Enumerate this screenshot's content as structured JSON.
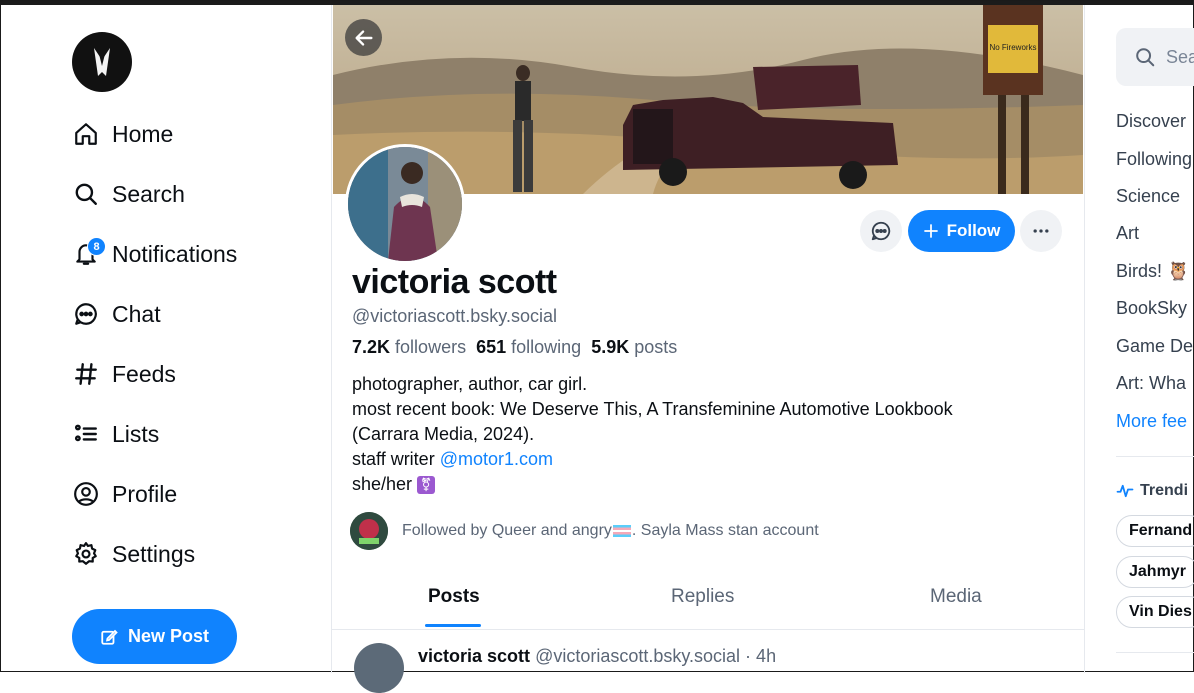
{
  "nav": {
    "items": [
      {
        "label": "Home",
        "icon": "home-icon"
      },
      {
        "label": "Search",
        "icon": "search-icon"
      },
      {
        "label": "Notifications",
        "icon": "bell-icon",
        "badge": "8"
      },
      {
        "label": "Chat",
        "icon": "chat-icon"
      },
      {
        "label": "Feeds",
        "icon": "hash-icon"
      },
      {
        "label": "Lists",
        "icon": "list-icon"
      },
      {
        "label": "Profile",
        "icon": "user-circle-icon"
      },
      {
        "label": "Settings",
        "icon": "gear-icon"
      }
    ],
    "new_post_label": "New Post"
  },
  "banner_sign": "No Fireworks",
  "profile": {
    "display_name": "victoria scott",
    "handle": "@victoriascott.bsky.social",
    "followers_count": "7.2K",
    "followers_label": "followers",
    "following_count": "651",
    "following_label": "following",
    "posts_count": "5.9K",
    "posts_label": "posts",
    "bio_line1": "photographer, author, car girl.",
    "bio_line2": "most recent book: We Deserve This, A Transfeminine Automotive Lookbook",
    "bio_line3": "(Carrara Media, 2024).",
    "bio_line4_prefix": "staff writer ",
    "bio_line4_link": "@motor1.com",
    "bio_line5": "she/her",
    "followed_by_prefix": "Followed by Queer and angry",
    "followed_by_suffix": ". Sayla Mass stan account",
    "follow_label": "Follow"
  },
  "tabs": [
    "Posts",
    "Replies",
    "Media"
  ],
  "post_preview": {
    "name": "victoria scott",
    "meta": "@victoriascott.bsky.social · 4h"
  },
  "right": {
    "search_placeholder": "Sea",
    "feeds": [
      "Discover",
      "Following",
      "Science",
      "Art",
      "Birds! 🦉",
      "BookSky",
      "Game De",
      "Art: Wha"
    ],
    "more_feeds": "More fee",
    "trending_label": "Trendi",
    "trending_chips": [
      "Fernand",
      "Jahmyr",
      "Vin Dies"
    ]
  },
  "colors": {
    "accent": "#1083fe",
    "text": "#0b0f14",
    "muted": "#5b6676"
  }
}
